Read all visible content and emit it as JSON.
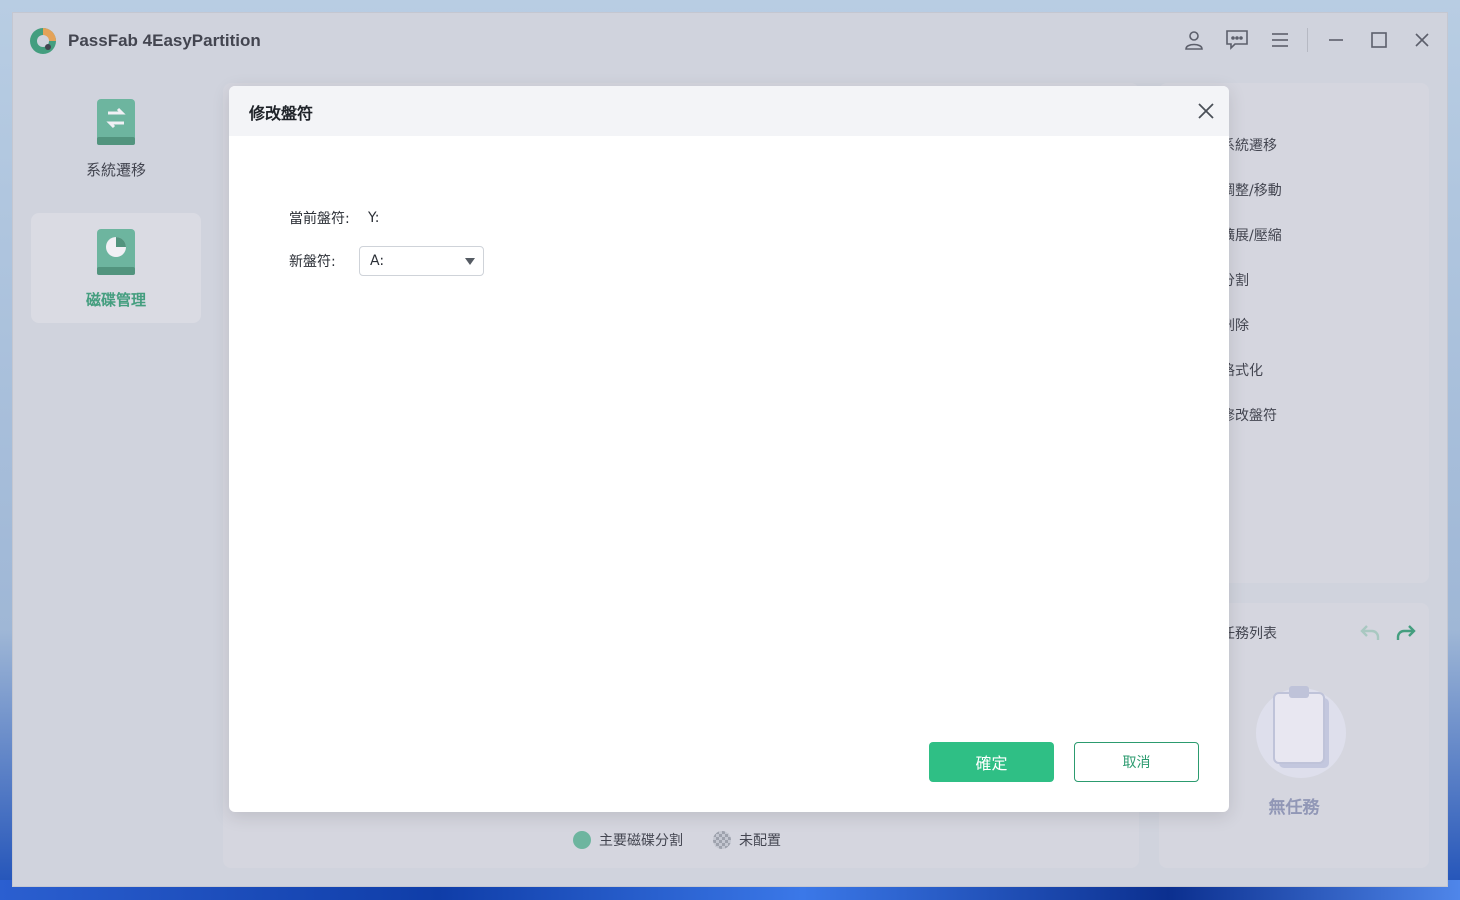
{
  "app": {
    "title": "PassFab 4EasyPartition"
  },
  "window_controls": [
    {
      "icon": "user-icon"
    },
    {
      "icon": "feedback-icon"
    },
    {
      "icon": "menu-icon"
    },
    {
      "icon": "minimize-icon"
    },
    {
      "icon": "maximize-icon"
    },
    {
      "icon": "close-icon"
    }
  ],
  "sidebar": {
    "items": [
      {
        "label": "系統遷移",
        "icon": "system-migrate-icon",
        "active": false
      },
      {
        "label": "磁碟管理",
        "icon": "disk-manage-icon",
        "active": true
      }
    ]
  },
  "operations": {
    "items": [
      {
        "label": "系統遷移"
      },
      {
        "label": "調整/移動"
      },
      {
        "label": "擴展/壓縮"
      },
      {
        "label": "分割"
      },
      {
        "label": "刪除"
      },
      {
        "label": "格式化"
      },
      {
        "label": "修改盤符"
      }
    ]
  },
  "tasks": {
    "title": "任務列表",
    "empty_label": "無任務"
  },
  "legend": {
    "primary": "主要磁碟分割",
    "unallocated": "未配置"
  },
  "modal": {
    "title": "修改盤符",
    "current_label": "當前盤符:",
    "current_value": "Y:",
    "new_label": "新盤符:",
    "new_value": "A:",
    "confirm_label": "確定",
    "cancel_label": "取消"
  },
  "colors": {
    "accent": "#2fbf85",
    "accent_dark": "#2c9b6f",
    "empty_text": "#8a93b3"
  }
}
